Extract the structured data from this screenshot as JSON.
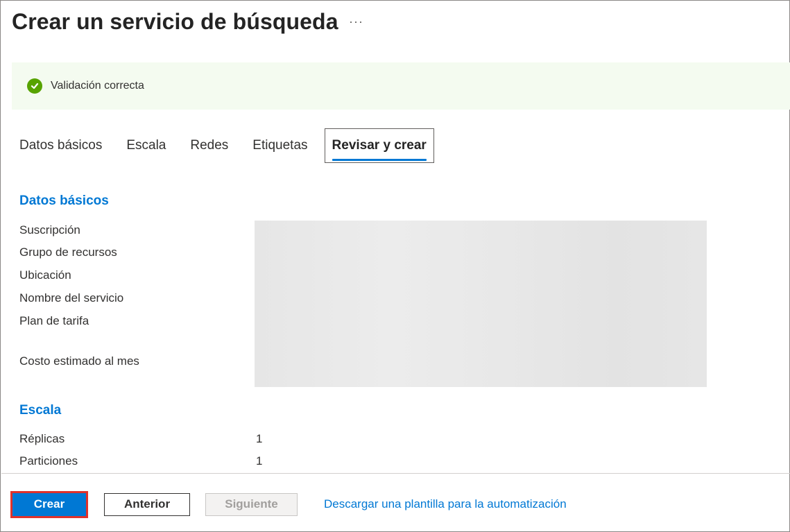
{
  "header": {
    "title": "Crear un servicio de búsqueda",
    "more_label": "···"
  },
  "banner": {
    "icon": "success-check-icon",
    "text": "Validación correcta",
    "color": "#57a300"
  },
  "tabs": [
    {
      "label": "Datos básicos",
      "active": false
    },
    {
      "label": "Escala",
      "active": false
    },
    {
      "label": "Redes",
      "active": false
    },
    {
      "label": "Etiquetas",
      "active": false
    },
    {
      "label": "Revisar y crear",
      "active": true
    }
  ],
  "basics": {
    "title": "Datos básicos",
    "fields": [
      {
        "label": "Suscripción"
      },
      {
        "label": "Grupo de recursos"
      },
      {
        "label": "Ubicación"
      },
      {
        "label": "Nombre del servicio"
      },
      {
        "label": "Plan de tarifa"
      },
      {
        "label": "Costo estimado al mes"
      }
    ]
  },
  "scale": {
    "title": "Escala",
    "fields": [
      {
        "label": "Réplicas",
        "value": "1"
      },
      {
        "label": "Particiones",
        "value": "1"
      }
    ]
  },
  "footer": {
    "create_label": "Crear",
    "previous_label": "Anterior",
    "next_label": "Siguiente",
    "template_link": "Descargar una plantilla para la automatización"
  },
  "colors": {
    "accent": "#0078d4",
    "highlight": "#e0322b"
  }
}
